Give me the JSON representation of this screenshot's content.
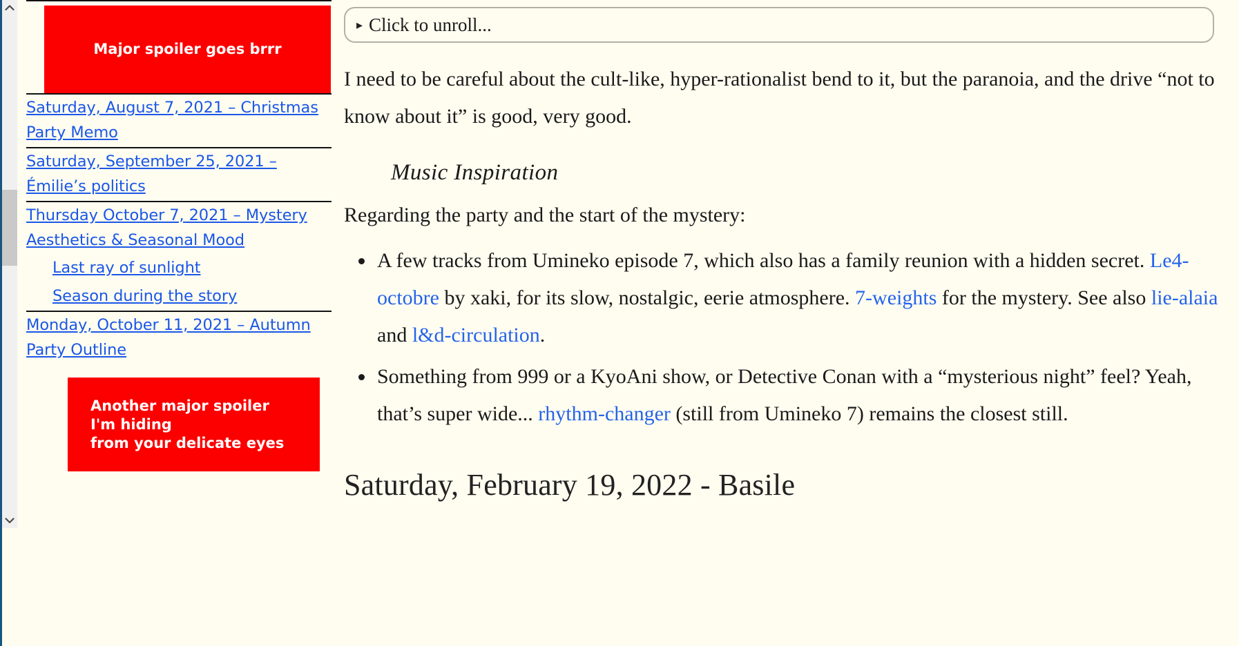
{
  "scrollbar": {
    "up_arrow_icon": "chevron-up-icon",
    "down_arrow_icon": "chevron-down-icon"
  },
  "sidebar": {
    "spoiler_top": {
      "text": "Major spoiler goes brrr",
      "background_color": "#fc0000",
      "text_color": "#ffffff"
    },
    "entries": [
      {
        "label": "Saturday, August 7, 2021 – Christmas Party Memo",
        "level": 1
      },
      {
        "label": "Saturday, September 25, 2021 – Émilie’s politics",
        "level": 1
      },
      {
        "label": "Thursday October 7, 2021 – Mystery Aesthetics & Seasonal Mood",
        "level": 1
      },
      {
        "label": "Last ray of sunlight",
        "level": 2
      },
      {
        "label": "Season during the story",
        "level": 2
      },
      {
        "label": "Monday, October 11, 2021 – Autumn Party Outline",
        "level": 1
      }
    ],
    "spoiler_bottom": {
      "line1": "Another major spoiler",
      "line2": "I'm hiding",
      "line3": "from your delicate eyes",
      "background_color": "#fc0000",
      "text_color": "#ffffff"
    },
    "link_color": "#1a56e8"
  },
  "main": {
    "unroll": {
      "marker": "▸",
      "label": "Click to unroll..."
    },
    "paragraph_1": "I need to be careful about the cult-like, hyper-rationalist bend to it, but the paranoia, and the drive “not to know about it” is good, very good.",
    "music_heading": "Music Inspiration",
    "paragraph_2": "Regarding the party and the start of the mystery:",
    "bullets": [
      {
        "part_1": "A few tracks from Umineko episode 7, which also has a family reunion with a hidden secret. ",
        "link_1": "Le4-octobre",
        "part_2": " by xaki, for its slow, nostalgic, eerie atmosphere. ",
        "link_2": "7-weights",
        "part_3": " for the mystery. See also ",
        "link_3": "lie-alaia",
        "part_4": " and ",
        "link_4": "l&d-circulation",
        "part_5": "."
      },
      {
        "part_1": "Something from 999 or a KyoAni show, or Detective Conan with a “mysterious night” feel? Yeah, that’s super wide... ",
        "link_1": "rhythm-changer",
        "part_2": " (still from Umineko 7) remains the closest still."
      }
    ],
    "next_heading": "Saturday, February 19, 2022 - Basile",
    "link_color": "#2563eb",
    "background_color": "#fffdf0"
  }
}
